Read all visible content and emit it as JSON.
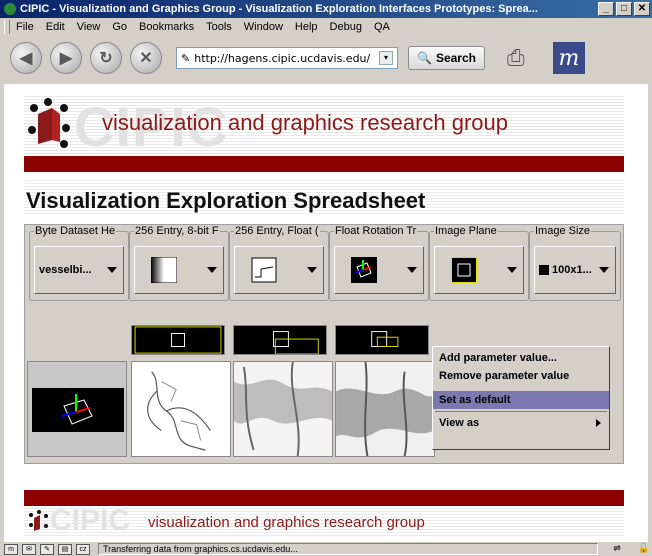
{
  "window": {
    "title": "CIPIC - Visualization and Graphics Group - Visualization Exploration Interfaces Prototypes: Sprea...",
    "minimize": "_",
    "maximize": "□",
    "close": "✕"
  },
  "menu": [
    "File",
    "Edit",
    "View",
    "Go",
    "Bookmarks",
    "Tools",
    "Window",
    "Help",
    "Debug",
    "QA"
  ],
  "nav": {
    "url": "http://hagens.cipic.ucdavis.edu/",
    "search_label": "Search"
  },
  "banner": {
    "ghost_text": "CIPIC",
    "text": "visualization and graphics research group"
  },
  "page": {
    "title": "Visualization Exploration Spreadsheet"
  },
  "params": [
    {
      "label": "Byte Dataset He",
      "value": "vesselbi..."
    },
    {
      "label": "256 Entry, 8-bit F",
      "value": ""
    },
    {
      "label": "256 Entry, Float (",
      "value": ""
    },
    {
      "label": "Float Rotation Tr",
      "value": ""
    },
    {
      "label": "Image Plane",
      "value": ""
    },
    {
      "label": "Image Size",
      "value": "100x1..."
    }
  ],
  "context_menu": {
    "items": [
      "Add parameter value...",
      "Remove parameter value",
      "Set as default",
      "View as"
    ]
  },
  "footer": {
    "ghost_text": "CIPIC",
    "text": "visualization and graphics research group"
  },
  "status": {
    "text": "Transferring data from graphics.cs.ucdavis.edu..."
  },
  "colors": {
    "brand_red": "#8b0000",
    "title_bar": "#0a246a",
    "menu_highlight": "#7a7ab0"
  }
}
